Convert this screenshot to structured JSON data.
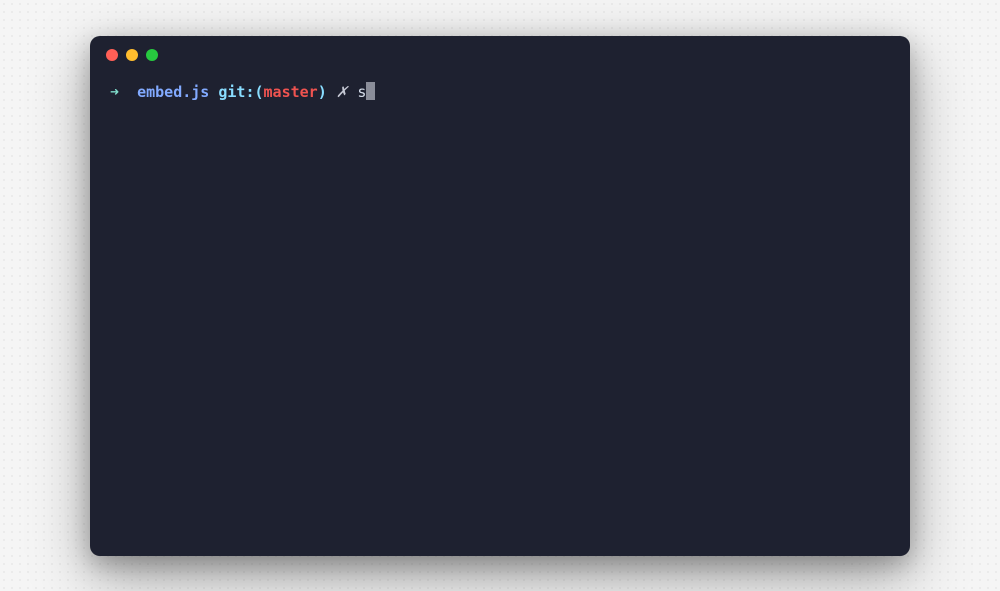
{
  "prompt": {
    "arrow": "➜",
    "directory": "embed.js",
    "git_label": "git:",
    "paren_open": "(",
    "branch": "master",
    "paren_close": ")",
    "dirty_marker": "✗",
    "typed_input": "s"
  },
  "colors": {
    "bg": "#1e2130",
    "arrow": "#7fdbca",
    "dir": "#82aaff",
    "git": "#89ddff",
    "branch": "#ef5350",
    "text": "#d6deeb"
  }
}
